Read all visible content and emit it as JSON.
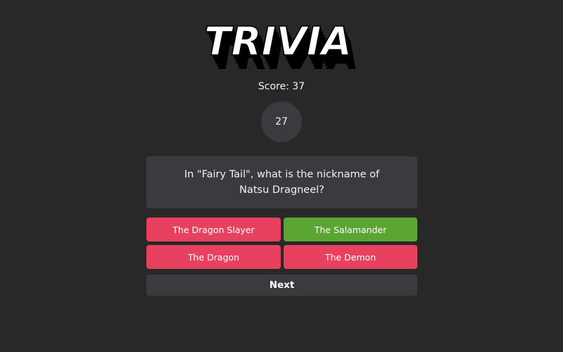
{
  "logo": {
    "text": "TRIVIA"
  },
  "score": {
    "text": "Score: 37"
  },
  "timer": {
    "value": "27"
  },
  "question": {
    "text": "In \"Fairy Tail\", what is the nickname of Natsu Dragneel?"
  },
  "answers": [
    {
      "label": "The Dragon Slayer",
      "state": "wrong"
    },
    {
      "label": "The Salamander",
      "state": "correct"
    },
    {
      "label": "The Dragon",
      "state": "wrong"
    },
    {
      "label": "The Demon",
      "state": "wrong"
    }
  ],
  "next": {
    "label": "Next"
  },
  "colors": {
    "background": "#282828",
    "panel": "#3a3b3f",
    "wrong": "#e8405f",
    "correct": "#5ba533"
  }
}
